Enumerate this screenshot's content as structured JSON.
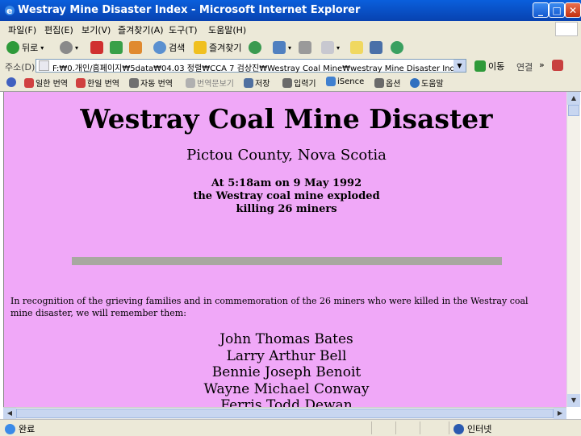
{
  "window": {
    "title": "Westray Mine Disaster Index - Microsoft Internet Explorer"
  },
  "menu": [
    "파일(F)",
    "편집(E)",
    "보기(V)",
    "즐겨찾기(A)",
    "도구(T)",
    "도움말(H)"
  ],
  "toolbar": {
    "back": "뒤로",
    "search": "검색",
    "favorites": "즐겨찾기"
  },
  "address": {
    "label": "주소(D)",
    "value": "F:₩0.개인/홈페이지₩5data₩04.03 정렬₩CCA 7 검상진₩Westray Coal Mine₩westray Mine Disaster Index.htm",
    "go": "이동",
    "links": "연결"
  },
  "links_bar": [
    "일한 번역",
    "한일 번역",
    "자동 번역",
    "번역문보기",
    "저장",
    "입력기",
    "iSence",
    "옵션",
    "도움말"
  ],
  "page": {
    "title": "Westray Coal Mine Disaster",
    "subtitle": "Pictou County, Nova Scotia",
    "event_lines": [
      "At 5:18am on 9 May 1992",
      "the Westray coal mine exploded",
      "killing 26 miners"
    ],
    "recognition": "In recognition of the grieving families and in commemoration of the 26 miners who were killed in the Westray coal mine disaster, we will remember them:",
    "names": [
      "John Thomas Bates",
      "Larry Arthur Bell",
      "Bennie Joseph Benoit",
      "Wayne Michael Conway",
      "Ferris Todd Dewan"
    ]
  },
  "status": {
    "left": "완료",
    "right": "인터넷"
  }
}
